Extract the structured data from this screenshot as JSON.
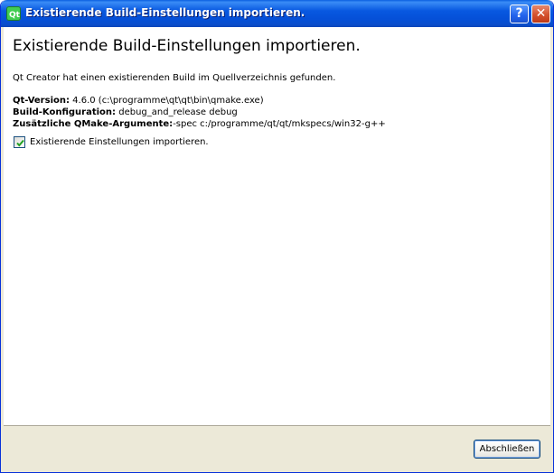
{
  "window": {
    "title": "Existierende Build-Einstellungen importieren.",
    "help_label": "?",
    "close_label": "✕",
    "app_icon": "qt-creator-icon"
  },
  "page": {
    "heading": "Existierende Build-Einstellungen importieren.",
    "intro": "Qt Creator hat einen existierenden Build im Quellverzeichnis gefunden.",
    "qt_version_label": "Qt-Version:",
    "qt_version_value": " 4.6.0 (c:\\programme\\qt\\qt\\bin\\qmake.exe)",
    "build_config_label": "Build-Konfiguration:",
    "build_config_value": " debug_and_release debug",
    "qmake_args_label": "Zusätzliche QMake-Argumente:",
    "qmake_args_value": "-spec c:/programme/qt/qt/mkspecs/win32-g++",
    "import_checkbox_label": "Existierende Einstellungen importieren.",
    "import_checked": true
  },
  "footer": {
    "finish_label": "Abschließen"
  },
  "colors": {
    "titlebar": "#0858e0",
    "checkmark": "#21a121"
  }
}
